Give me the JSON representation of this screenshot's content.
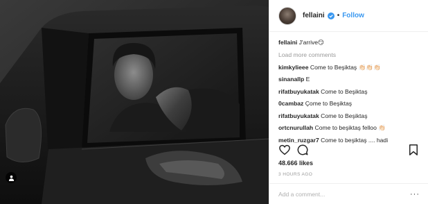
{
  "post": {
    "username": "fellaini",
    "follow_label": "Follow",
    "separator": "•",
    "caption_user": "fellaini",
    "caption_text": "J'arrive😏",
    "load_more": "Load more comments",
    "comments": [
      {
        "user": "kimkylieee",
        "text": "Come to Beşiktaş 👏🏻👏🏻👏🏻"
      },
      {
        "user": "sinanallp",
        "text": "E"
      },
      {
        "user": "rifatbuyukatak",
        "text": "Come to Beşiktaş"
      },
      {
        "user": "0cambaz",
        "text": "Çome to Beşiktaş"
      },
      {
        "user": "rifatbuyukatak",
        "text": "Come to Beşiktaş"
      },
      {
        "user": "ortcnurullah",
        "text": "Come to beşiktaş felloo 👏🏻"
      },
      {
        "user": "metin_ruzgar7",
        "text": "Come to beşiktaş .... hadi"
      }
    ],
    "likes": "48.666 likes",
    "time": "3 HOURS AGO",
    "add_comment_placeholder": "Add a comment...",
    "more_label": "···"
  },
  "colors": {
    "link": "#3897f0",
    "text": "#262626",
    "muted": "#999999",
    "verified": "#3897f0"
  },
  "icons": [
    "heart-icon",
    "comment-icon",
    "bookmark-icon",
    "verified-badge-icon",
    "user-tag-icon"
  ]
}
